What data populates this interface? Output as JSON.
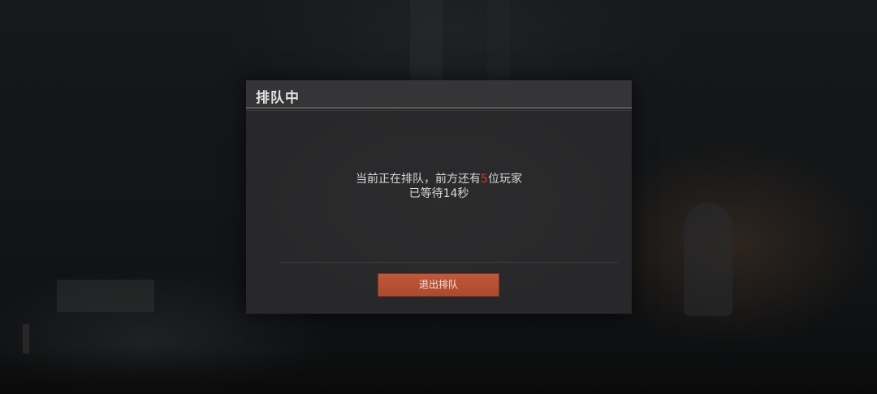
{
  "dialog": {
    "title": "排队中",
    "queue_prefix": "当前正在排队，前方还有",
    "queue_count": "5",
    "queue_suffix": "位玩家",
    "wait_text": "已等待14秒",
    "quit_button_label": "退出排队"
  },
  "colors": {
    "accent_button": "#b9543a",
    "count_highlight": "#d23a2a",
    "dialog_bg": "#28282a"
  }
}
